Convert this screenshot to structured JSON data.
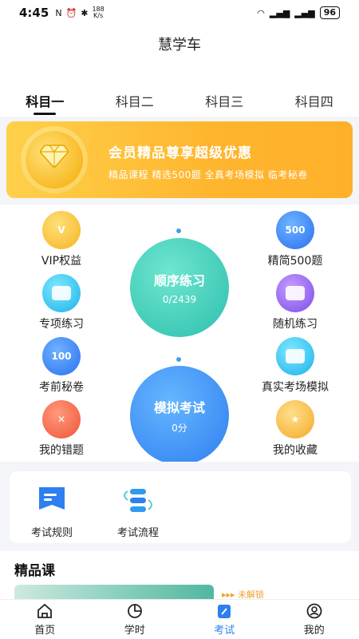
{
  "status_bar": {
    "time": "4:45",
    "net_speed_value": "188",
    "net_speed_unit": "K/s",
    "battery": "96"
  },
  "app_title": "慧学车",
  "tabs": [
    {
      "label": "科目一",
      "active": true
    },
    {
      "label": "科目二",
      "active": false
    },
    {
      "label": "科目三",
      "active": false
    },
    {
      "label": "科目四",
      "active": false
    }
  ],
  "banner": {
    "title": "会员精品尊享超级优惠",
    "subtitle": "精品课程  精选500题  全真考场模拟  临考秘卷"
  },
  "features": {
    "vip": "VIP权益",
    "select500": "精简500题",
    "select500_badge": "500",
    "special": "专项练习",
    "random": "随机练习",
    "secret": "考前秘卷",
    "secret_badge": "100",
    "real_exam": "真实考场模拟",
    "mistakes": "我的错题",
    "favorites": "我的收藏"
  },
  "sequential": {
    "label": "顺序练习",
    "progress": "0/2439"
  },
  "mock_exam": {
    "label": "模拟考试",
    "score": "0分"
  },
  "rules": {
    "exam_rules": "考试规则",
    "exam_process": "考试流程"
  },
  "course": {
    "section_title": "精品课",
    "locked": "未解锁"
  },
  "nav": {
    "home": "首页",
    "hours": "学时",
    "exam": "考试",
    "mine": "我的",
    "active": "exam"
  },
  "colors": {
    "accent": "#2e7ff0",
    "banner": "#ffb52e",
    "teal": "#2cbfae"
  }
}
